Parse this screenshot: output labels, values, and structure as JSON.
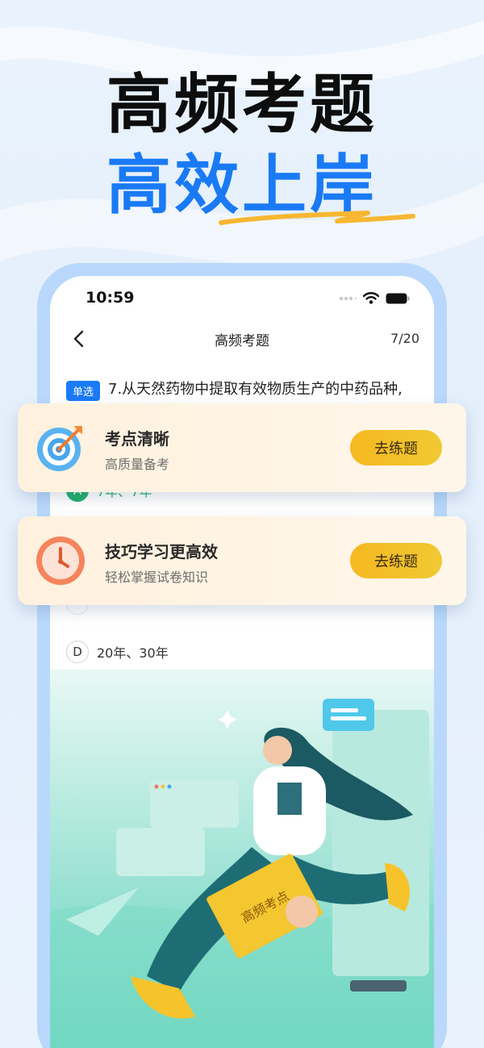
{
  "hero": {
    "line1": "高频考题",
    "line2": "高效上岸"
  },
  "status": {
    "time": "10:59"
  },
  "nav": {
    "title": "高频考题",
    "progress": "7/20"
  },
  "question": {
    "badge": "单选",
    "text": "7.从天然药物中提取有效物质生产的中药品种,"
  },
  "options": [
    {
      "letter": "A",
      "text": "7年、7年",
      "state": "correct"
    },
    {
      "letter": "D",
      "text": "20年、30年",
      "state": "normal"
    }
  ],
  "cards": [
    {
      "title": "考点清晰",
      "subtitle": "高质量备考",
      "button": "去练题",
      "icon": "target-icon"
    },
    {
      "title": "技巧学习更高效",
      "subtitle": "轻松掌握试卷知识",
      "button": "去练题",
      "icon": "clock-icon"
    }
  ],
  "illustration": {
    "book_title": "高频考点"
  },
  "colors": {
    "brand_blue": "#1a7af5",
    "correct_green": "#23b06b",
    "button_yellow": "#f6b820"
  }
}
